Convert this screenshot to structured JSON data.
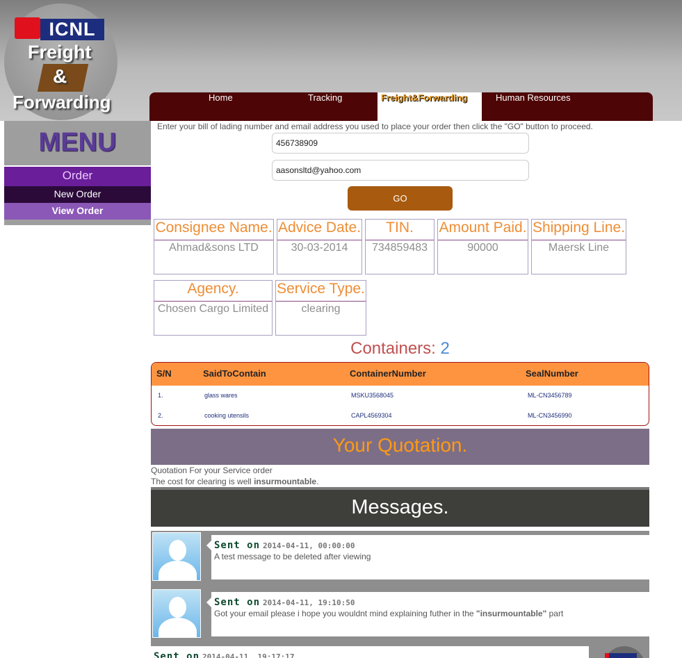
{
  "logo": {
    "brand": "ICNL",
    "line1": "Freight",
    "line2": "&",
    "line3": "Forwarding"
  },
  "nav": {
    "items": [
      {
        "label": "Home"
      },
      {
        "label": "Tracking"
      },
      {
        "label": "Freight&Forwarding",
        "active": true
      },
      {
        "label": "Human Resources"
      }
    ]
  },
  "sidebar": {
    "title": "MENU",
    "section": "Order",
    "items": [
      {
        "label": "New Order"
      },
      {
        "label": "View Order",
        "active": true
      }
    ]
  },
  "form": {
    "instruction": "Enter your bill of lading number and email address you used to place your order then click the \"GO\" button to proceed.",
    "bill_of_lading": "456738909",
    "email": "aasonsltd@yahoo.com",
    "go_label": "GO"
  },
  "order_info": {
    "consignee": {
      "label": "Consignee Name.",
      "value": "Ahmad&sons LTD"
    },
    "advice_date": {
      "label": "Advice Date.",
      "value": "30-03-2014"
    },
    "tin": {
      "label": "TIN.",
      "value": "734859483"
    },
    "amount_paid": {
      "label": "Amount Paid.",
      "value": "90000"
    },
    "shipping_line": {
      "label": "Shipping Line.",
      "value": "Maersk Line"
    },
    "agency": {
      "label": "Agency.",
      "value": "Chosen Cargo Limited"
    },
    "service_type": {
      "label": "Service Type.",
      "value": "clearing"
    }
  },
  "containers": {
    "heading": "Containers:",
    "count": "2",
    "columns": [
      "S/N",
      "SaidToContain",
      "ContainerNumber",
      "SealNumber"
    ],
    "rows": [
      {
        "sn": "1.",
        "contents": "glass wares",
        "container": "MSKU3568045",
        "seal": "ML-CN3456789"
      },
      {
        "sn": "2.",
        "contents": "cooking utensils",
        "container": "CAPL4569304",
        "seal": "ML-CN3456990"
      }
    ]
  },
  "quotation": {
    "title": "Your Quotation.",
    "line1": "Quotation For your Service order",
    "line2_prefix": "The cost for clearing is well ",
    "line2_bold": "insurmountable",
    "line2_suffix": "."
  },
  "messages": {
    "title": "Messages.",
    "items": [
      {
        "sent_label": "Sent on",
        "time": "2014-04-11, 00:00:00",
        "body_prefix": "A test message to be deleted after viewing",
        "body_bold": "",
        "body_suffix": ""
      },
      {
        "sent_label": "Sent on",
        "time": "2014-04-11, 19:10:50",
        "body_prefix": "Got your email please i hope you wouldnt mind explaining futher in the ",
        "body_bold": "\"insurmountable\"",
        "body_suffix": " part"
      },
      {
        "sent_label": "Sent on",
        "time": "2014-04-11, 19:17:17"
      }
    ]
  }
}
